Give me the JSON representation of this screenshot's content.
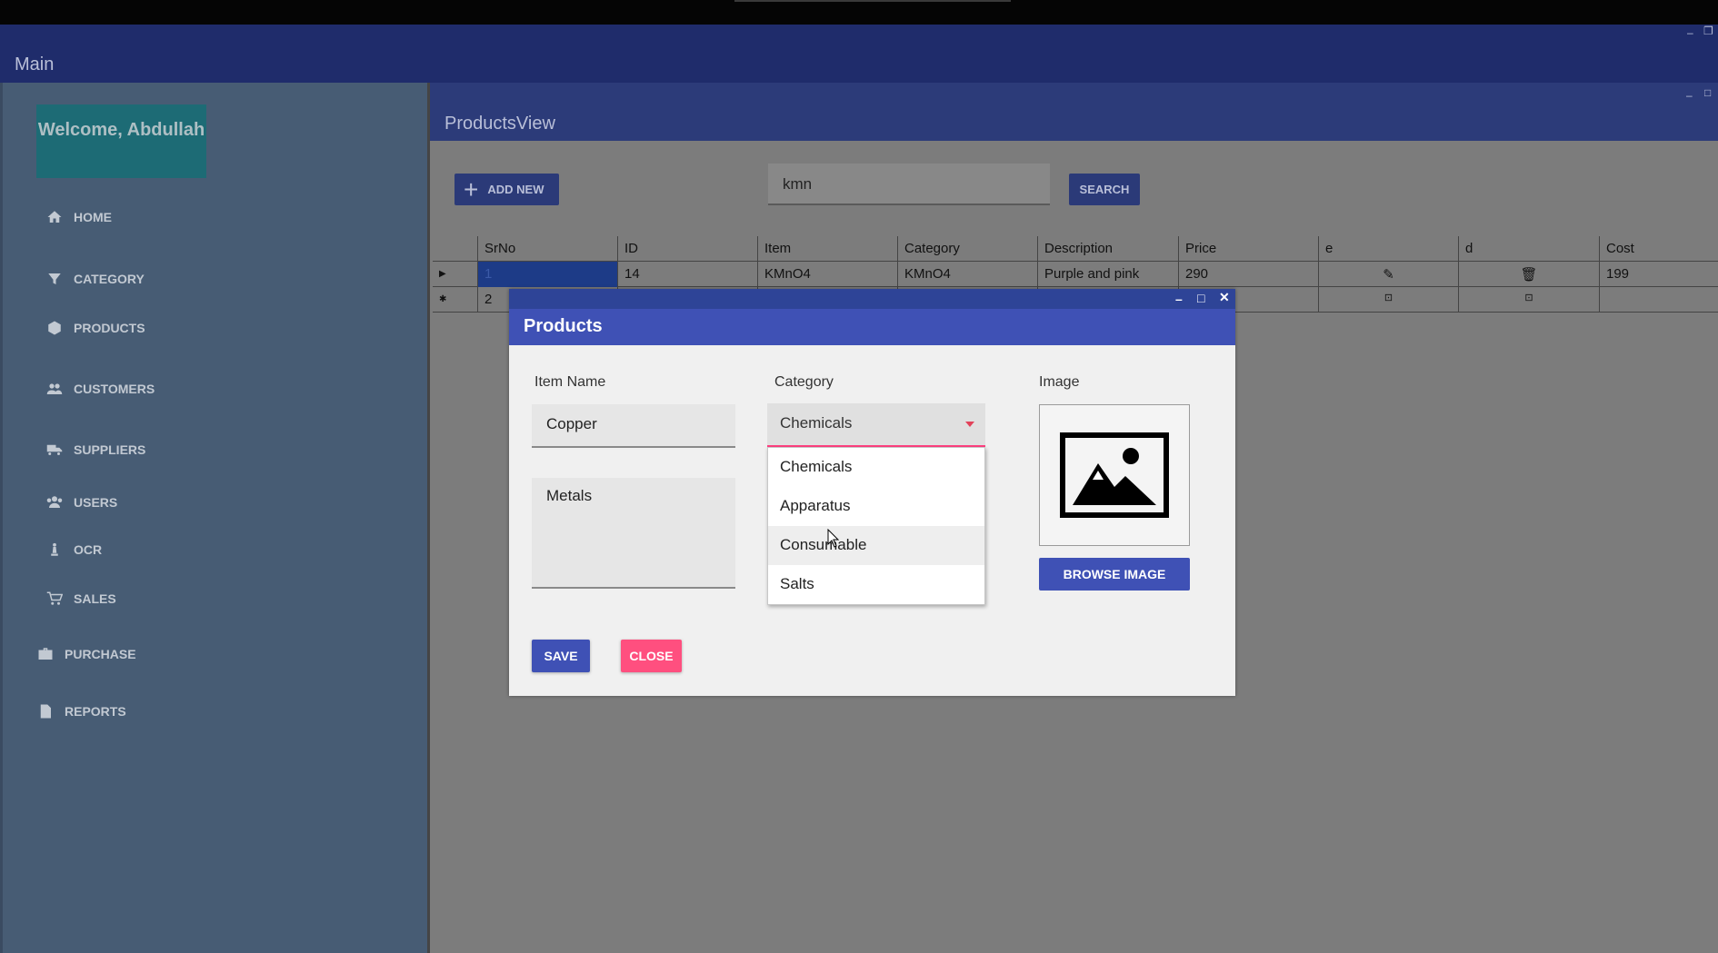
{
  "main_window": {
    "title": "Main"
  },
  "sidebar": {
    "welcome": "Welcome, Abdullah",
    "items": [
      {
        "label": "HOME",
        "icon": "home-icon"
      },
      {
        "label": "CATEGORY",
        "icon": "filter-icon"
      },
      {
        "label": "PRODUCTS",
        "icon": "box-icon"
      },
      {
        "label": "CUSTOMERS",
        "icon": "people-icon"
      },
      {
        "label": "SUPPLIERS",
        "icon": "truck-icon"
      },
      {
        "label": "USERS",
        "icon": "users-icon"
      },
      {
        "label": "OCR",
        "icon": "chess-icon"
      },
      {
        "label": "SALES",
        "icon": "cart-icon"
      },
      {
        "label": "PURCHASE",
        "icon": "briefcase-icon"
      },
      {
        "label": "REPORTS",
        "icon": "document-icon"
      }
    ]
  },
  "products_view": {
    "title": "ProductsView",
    "add_new_label": "ADD NEW",
    "search_value": "kmn",
    "search_label": "SEARCH"
  },
  "grid": {
    "columns": [
      "SrNo",
      "ID",
      "Item",
      "Category",
      "Description",
      "Price",
      "e",
      "d",
      "Cost"
    ],
    "rows": [
      {
        "SrNo": "1",
        "ID": "14",
        "Item": "KMnO4",
        "Category": "KMnO4",
        "Description": "Purple and pink",
        "Price": "290",
        "Cost": "199"
      },
      {
        "SrNo": "2",
        "ID": "",
        "Item": "",
        "Category": "",
        "Description": "",
        "Price": "",
        "Cost": ""
      }
    ]
  },
  "dialog": {
    "title": "Products",
    "item_name_label": "Item Name",
    "item_name_value": "Copper",
    "description_value": "Metals",
    "category_label": "Category",
    "category_selected": "Chemicals",
    "category_options": [
      "Chemicals",
      "Apparatus",
      "Consumable",
      "Salts"
    ],
    "image_label": "Image",
    "browse_label": "BROWSE IMAGE",
    "save_label": "SAVE",
    "close_label": "CLOSE"
  },
  "colors": {
    "primary": "#3f51b5",
    "accent": "#ff4081",
    "sidebar_bg": "#475c74",
    "welcome_bg": "#1d6b75"
  }
}
